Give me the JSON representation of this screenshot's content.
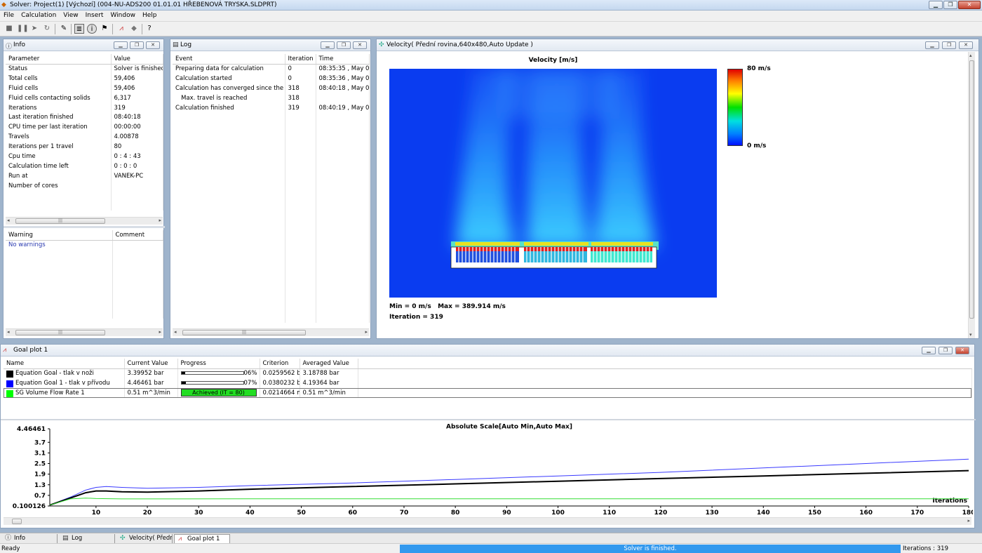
{
  "window": {
    "title": "Solver: Project(1) [Výchozí] (004-NU-ADS200 01.01.01 HŘEBENOVÁ TRYSKA.SLDPRT)"
  },
  "menu": [
    "File",
    "Calculation",
    "View",
    "Insert",
    "Window",
    "Help"
  ],
  "info_panel": {
    "title": "Info",
    "col_param": "Parameter",
    "col_value": "Value",
    "rows": [
      {
        "p": "Status",
        "v": "Solver is finished."
      },
      {
        "p": "Total cells",
        "v": "59,406"
      },
      {
        "p": "Fluid cells",
        "v": "59,406"
      },
      {
        "p": "Fluid cells contacting solids",
        "v": "6,317"
      },
      {
        "p": "Iterations",
        "v": "319"
      },
      {
        "p": "Last iteration finished",
        "v": "08:40:18"
      },
      {
        "p": "CPU time per last iteration",
        "v": "00:00:00"
      },
      {
        "p": "Travels",
        "v": "4.00878"
      },
      {
        "p": "Iterations per 1 travel",
        "v": "80"
      },
      {
        "p": "Cpu time",
        "v": "0 : 4 : 43"
      },
      {
        "p": "Calculation time left",
        "v": "0 : 0 : 0"
      },
      {
        "p": "Run at",
        "v": "VANEK-PC"
      },
      {
        "p": "Number of cores",
        "v": ""
      }
    ],
    "warn_col": "Warning",
    "comment_col": "Comment",
    "no_warnings": "No warnings"
  },
  "log_panel": {
    "title": "Log",
    "col_event": "Event",
    "col_iter": "Iteration",
    "col_time": "Time",
    "rows": [
      {
        "e": "Preparing data for calculation",
        "i": "0",
        "t": "08:35:35 , May 03"
      },
      {
        "e": "Calculation started",
        "i": "0",
        "t": "08:35:36 , May 03"
      },
      {
        "e": "Calculation has converged since the f...",
        "i": "318",
        "t": "08:40:18 , May 03"
      },
      {
        "e": "   Max. travel is reached",
        "i": "318",
        "t": ""
      },
      {
        "e": "Calculation finished",
        "i": "319",
        "t": "08:40:19 , May 03"
      }
    ]
  },
  "velocity_panel": {
    "title": "Velocity( Přední rovina,640x480,Auto Update )",
    "plot_title": "Velocity [m/s]",
    "legend_max": "80 m/s",
    "legend_min": "0 m/s",
    "min_max": "Min = 0 m/s   Max = 389.914 m/s",
    "iteration": "Iteration = 319"
  },
  "goal_panel": {
    "title": "Goal plot 1",
    "cols": [
      "Name",
      "Current Value",
      "Progress",
      "Criterion",
      "Averaged Value"
    ],
    "rows": [
      {
        "name": "Equation Goal - tlak v noži",
        "color": "#000000",
        "cur": "3.39952 bar",
        "progress_text": "06%",
        "progress": 0.06,
        "crit": "0.0259562 ba",
        "avg": "3.18788 bar"
      },
      {
        "name": "Equation Goal 1 - tlak v přívodu",
        "color": "#0000ff",
        "cur": "4.46461 bar",
        "progress_text": "07%",
        "progress": 0.07,
        "crit": "0.0380232 ba",
        "avg": "4.19364 bar"
      },
      {
        "name": "SG Volume Flow Rate 1",
        "color": "#00ff00",
        "cur": "0.51 m^3/min",
        "progress_text": "Achieved (IT = 80)",
        "progress": 1,
        "crit": "0.0214664 m",
        "avg": "0.51 m^3/min"
      }
    ]
  },
  "chart_data": {
    "type": "line",
    "title": "Absolute Scale[Auto Min,Auto Max]",
    "xlabel": "Iterations",
    "ylabel": "",
    "x_ticks": [
      10,
      20,
      30,
      40,
      50,
      60,
      70,
      80,
      90,
      100,
      110,
      120,
      130,
      140,
      150,
      160,
      170,
      180
    ],
    "y_ticks": [
      "4.46461",
      "3.7",
      "3.1",
      "2.5",
      "1.9",
      "1.3",
      "0.7",
      "0.100126"
    ],
    "ylim": [
      0.100126,
      4.46461
    ],
    "xlim": [
      1,
      180
    ],
    "series": [
      {
        "color": "#3a3aff",
        "x": [
          1,
          5,
          8,
          10,
          12,
          15,
          20,
          30,
          40,
          60,
          80,
          100,
          120,
          140,
          160,
          180
        ],
        "y": [
          0.15,
          0.6,
          1.0,
          1.15,
          1.2,
          1.15,
          1.1,
          1.15,
          1.25,
          1.4,
          1.6,
          1.8,
          2.0,
          2.25,
          2.5,
          2.75
        ]
      },
      {
        "color": "#000000",
        "x": [
          1,
          5,
          8,
          10,
          12,
          15,
          20,
          30,
          40,
          60,
          80,
          100,
          120,
          140,
          160,
          180
        ],
        "y": [
          0.15,
          0.55,
          0.85,
          0.95,
          0.95,
          0.9,
          0.88,
          0.95,
          1.05,
          1.2,
          1.35,
          1.5,
          1.65,
          1.8,
          1.95,
          2.1
        ]
      },
      {
        "color": "#33dd33",
        "x": [
          1,
          5,
          8,
          10,
          15,
          20,
          40,
          80,
          120,
          180
        ],
        "y": [
          0.15,
          0.5,
          0.55,
          0.52,
          0.5,
          0.5,
          0.51,
          0.51,
          0.51,
          0.51
        ]
      }
    ]
  },
  "tabs": [
    "Info",
    "Log",
    "Velocity( Přední (",
    "Goal plot 1"
  ],
  "status": {
    "left": "Ready",
    "center": "Solver is finished.",
    "right": "Iterations : 319"
  }
}
